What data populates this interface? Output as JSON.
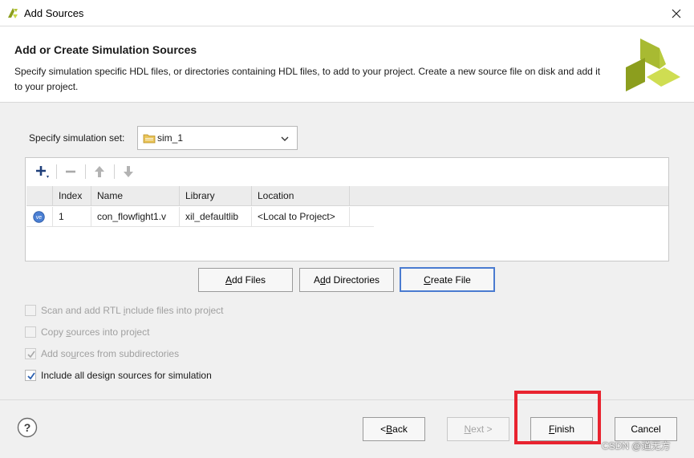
{
  "window": {
    "title": "Add Sources",
    "close_icon": "close-icon",
    "app_icon": "vivado-icon"
  },
  "header": {
    "title": "Add or Create Simulation Sources",
    "description": "Specify simulation specific HDL files, or directories containing HDL files, to add to your project. Create a new source file on disk and add it to your project.",
    "logo_icon": "xilinx-logo"
  },
  "simulation_set": {
    "label": "Specify simulation set:",
    "value": "sim_1"
  },
  "toolbar": {
    "add_icon": "plus-icon",
    "remove_icon": "minus-icon",
    "up_icon": "arrow-up-icon",
    "down_icon": "arrow-down-icon"
  },
  "table": {
    "columns": [
      "Index",
      "Name",
      "Library",
      "Location"
    ],
    "rows": [
      {
        "icon": "verilog-file-icon",
        "index": "1",
        "name": "con_flowfight1.v",
        "library": "xil_defaultlib",
        "location": "<Local to Project>"
      }
    ]
  },
  "actions": {
    "add_files": {
      "pre": "",
      "mnemonic": "A",
      "post": "dd Files"
    },
    "add_directories": {
      "pre": "A",
      "mnemonic": "d",
      "post": "d Directories"
    },
    "create_file": {
      "pre": "",
      "mnemonic": "C",
      "post": "reate File"
    }
  },
  "options": [
    {
      "pre": "Scan and add RTL ",
      "mnemonic": "i",
      "post": "nclude files into project",
      "checked": false,
      "enabled": false
    },
    {
      "pre": "Copy ",
      "mnemonic": "s",
      "post": "ources into project",
      "checked": false,
      "enabled": false
    },
    {
      "pre": "Add so",
      "mnemonic": "u",
      "post": "rces from subdirectories",
      "checked": true,
      "enabled": false
    },
    {
      "pre": "Include all design sources for simulation",
      "mnemonic": "",
      "post": "",
      "checked": true,
      "enabled": true
    }
  ],
  "footer": {
    "back": {
      "pre": "< ",
      "mnemonic": "B",
      "post": "ack"
    },
    "next": {
      "pre": "",
      "mnemonic": "N",
      "post": "ext >"
    },
    "finish": {
      "pre": "",
      "mnemonic": "F",
      "post": "inish"
    },
    "cancel": {
      "pre": "Cancel",
      "mnemonic": "",
      "post": ""
    },
    "help_icon": "help-icon"
  },
  "watermark": "CSDN @道无方",
  "colors": {
    "accent": "#4a7bd0",
    "highlight": "#e8232f",
    "checkbox": "#2a5fb0",
    "logo_dark": "#8c9e1e",
    "logo_light": "#c9d84a"
  }
}
